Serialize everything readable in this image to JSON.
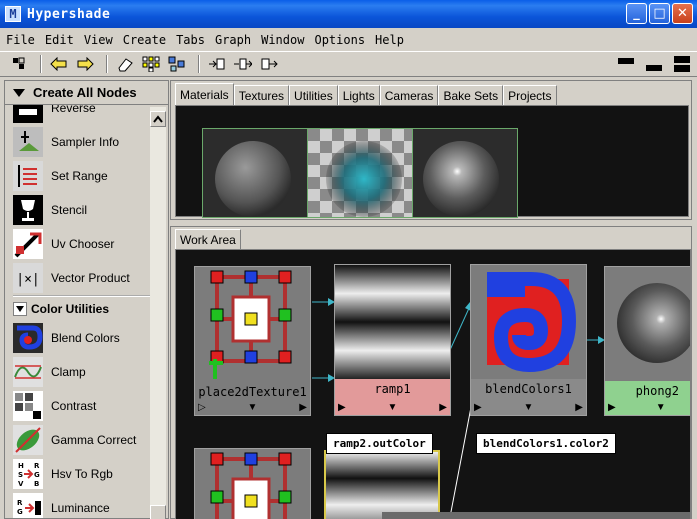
{
  "window": {
    "title": "Hypershade",
    "app_icon": "M",
    "minimize": "_",
    "maximize": "□",
    "close": "✕"
  },
  "menu": [
    "File",
    "Edit",
    "View",
    "Create",
    "Tabs",
    "Graph",
    "Window",
    "Options",
    "Help"
  ],
  "left_panel": {
    "header": "Create All Nodes",
    "items": [
      {
        "label": "Reverse",
        "icon": "reverse-icon"
      },
      {
        "label": "Sampler Info",
        "icon": "sampler-info-icon"
      },
      {
        "label": "Set Range",
        "icon": "set-range-icon"
      },
      {
        "label": "Stencil",
        "icon": "stencil-icon"
      },
      {
        "label": "Uv Chooser",
        "icon": "uv-chooser-icon"
      },
      {
        "label": "Vector Product",
        "icon": "vector-product-icon"
      }
    ],
    "section": "Color Utilities",
    "section_items": [
      {
        "label": "Blend Colors",
        "icon": "blend-colors-icon"
      },
      {
        "label": "Clamp",
        "icon": "clamp-icon"
      },
      {
        "label": "Contrast",
        "icon": "contrast-icon"
      },
      {
        "label": "Gamma Correct",
        "icon": "gamma-correct-icon"
      },
      {
        "label": "Hsv To Rgb",
        "icon": "hsv-to-rgb-icon"
      },
      {
        "label": "Luminance",
        "icon": "luminance-icon"
      }
    ]
  },
  "tabs": [
    "Materials",
    "Textures",
    "Utilities",
    "Lights",
    "Cameras",
    "Bake Sets",
    "Projects"
  ],
  "work_area": {
    "tab": "Work Area",
    "nodes": {
      "place2d": "place2dTexture1",
      "ramp": "ramp1",
      "blend": "blendColors1",
      "phong": "phong2"
    },
    "tooltips": {
      "source": "ramp2.outColor",
      "target": "blendColors1.color2"
    }
  },
  "colors": {
    "title_blue": "#0a5ee8",
    "ramp_label": "#e29a9a",
    "phong_label": "#8fd18f",
    "connection": "#3fb6c8"
  }
}
